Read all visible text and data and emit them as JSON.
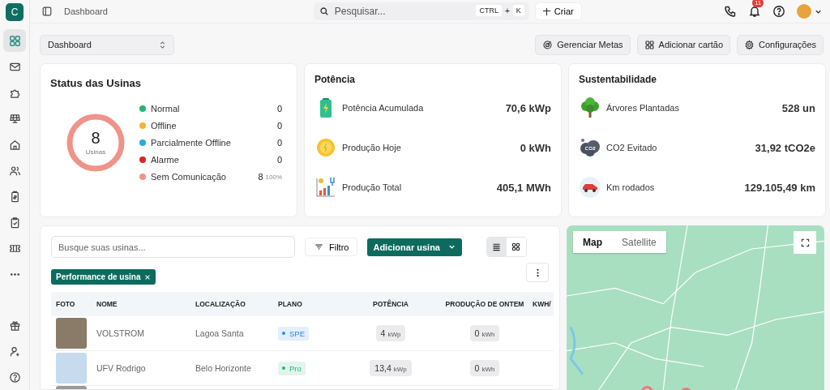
{
  "sidebar": {
    "logo": "C",
    "items": [
      {
        "selected": true
      },
      {
        "selected": false
      },
      {
        "selected": false
      },
      {
        "selected": false
      },
      {
        "selected": false
      },
      {
        "selected": false
      },
      {
        "selected": false
      },
      {
        "selected": false
      },
      {
        "selected": false
      },
      {
        "selected": false
      }
    ]
  },
  "topbar": {
    "breadcrumb": "Dashboard",
    "search": {
      "placeholder": "Pesquisar...",
      "keys": [
        "CTRL",
        "+",
        "K"
      ]
    },
    "create_button": "Criar",
    "notification_count": "11"
  },
  "toolbar": {
    "dashboard_select": "Dashboard",
    "buttons": [
      "Gerenciar Metas",
      "Adicionar cartão",
      "Configurações"
    ]
  },
  "status_card": {
    "title": "Status das Usinas",
    "total": "8",
    "total_label": "Usinas",
    "legend": [
      {
        "label": "Normal",
        "count": "0",
        "color": "#22b573"
      },
      {
        "label": "Offline",
        "count": "0",
        "color": "#f5b335"
      },
      {
        "label": "Parcialmente Offline",
        "count": "0",
        "color": "#2ea8e0"
      },
      {
        "label": "Alarme",
        "count": "0",
        "color": "#e02424"
      },
      {
        "label": "Sem Comunicação",
        "count": "8",
        "percent": "100%",
        "color": "#f0938a"
      }
    ]
  },
  "power_card": {
    "title": "Potência",
    "metrics": [
      {
        "label": "Potência Acumulada",
        "value": "70,6 kWp"
      },
      {
        "label": "Produção Hoje",
        "value": "0 kWh"
      },
      {
        "label": "Produção Total",
        "value": "405,1 MWh"
      }
    ]
  },
  "sustainability_card": {
    "title": "Sustentabilidade",
    "metrics": [
      {
        "label": "Árvores Plantadas",
        "value": "528 un"
      },
      {
        "label": "CO2 Evitado",
        "value": "31,92 tCO2e"
      },
      {
        "label": "Km rodados",
        "value": "129.105,49 km"
      }
    ]
  },
  "plants_panel": {
    "search_placeholder": "Busque suas usinas...",
    "filter_button": "Filtro",
    "add_button": "Adicionar usina",
    "views": [
      {
        "selected": true
      },
      {
        "selected": false
      }
    ],
    "chips": [
      "Performance de usina"
    ],
    "table": {
      "columns": [
        "FOTO",
        "NOME",
        "LOCALIZAÇÃO",
        "PLANO",
        "POTÊNCIA",
        "PRODUÇÃO DE ONTEM",
        "KWH/"
      ],
      "rows": [
        {
          "name": "VOLSTROM",
          "location": "Lagoa Santa",
          "plan": "SPE",
          "color": "#2e8ae6",
          "power": "4",
          "power_unit": "kWp",
          "yesterday": "0",
          "yesterday_unit": "kWh"
        },
        {
          "name": "UFV Rodrigo",
          "location": "Belo Horizonte",
          "plan": "Pro",
          "color": "#22b573",
          "power": "13,4",
          "power_unit": "kWp",
          "yesterday": "0",
          "yesterday_unit": "kWh"
        }
      ]
    }
  },
  "map": {
    "types": [
      {
        "label": "Map",
        "selected": true
      },
      {
        "label": "Satellite",
        "selected": false
      }
    ]
  }
}
